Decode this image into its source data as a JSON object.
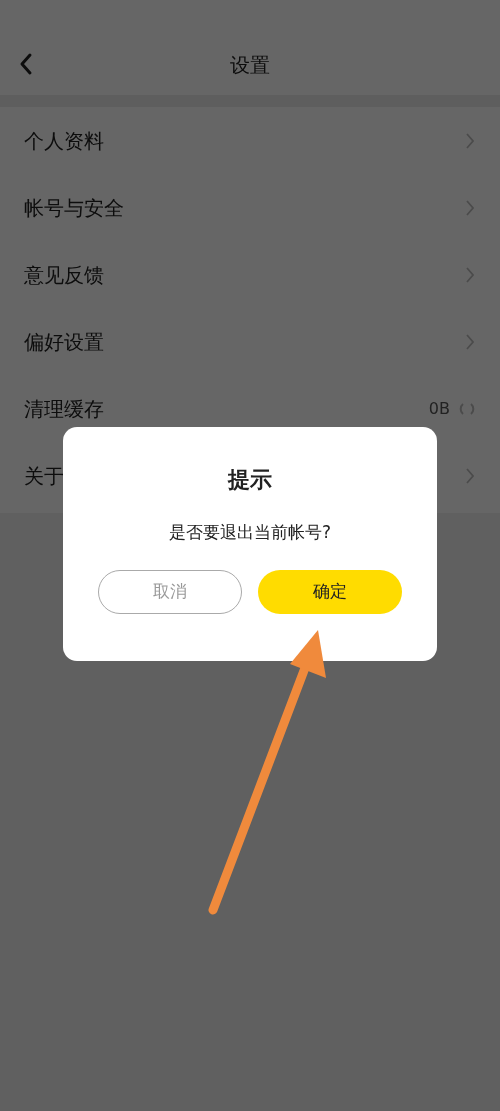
{
  "header": {
    "title": "设置"
  },
  "settings": [
    {
      "kind": "link",
      "label": "个人资料"
    },
    {
      "kind": "link",
      "label": "帐号与安全"
    },
    {
      "kind": "link",
      "label": "意见反馈"
    },
    {
      "kind": "link",
      "label": "偏好设置"
    },
    {
      "kind": "value",
      "label": "清理缓存",
      "value": "0B"
    },
    {
      "kind": "link",
      "label": "关于"
    }
  ],
  "dialog": {
    "title": "提示",
    "message": "是否要退出当前帐号?",
    "buttons": [
      {
        "kind": "secondary",
        "label": "取消"
      },
      {
        "kind": "primary",
        "label": "确定"
      }
    ]
  }
}
